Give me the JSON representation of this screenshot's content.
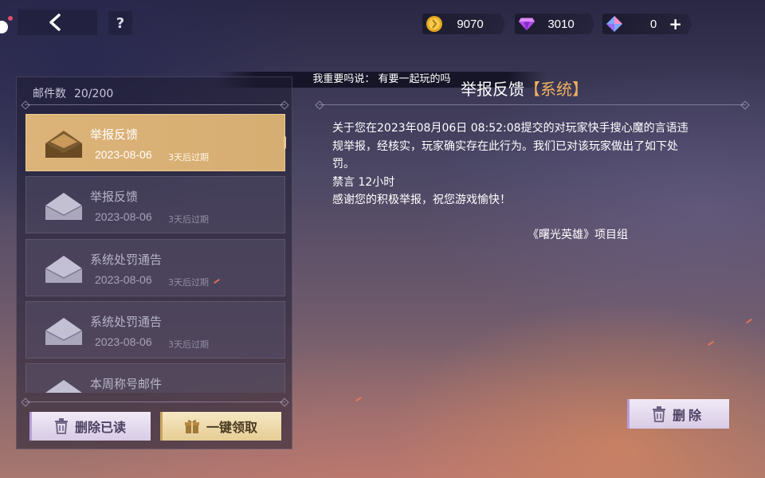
{
  "topbar": {
    "help_label": "?",
    "currencies": [
      {
        "name": "gold-coin",
        "value": "9070"
      },
      {
        "name": "purple-diamond",
        "value": "3010"
      },
      {
        "name": "crystal",
        "value": "0",
        "add_label": "+"
      }
    ]
  },
  "notice": "我重要吗说： 有要一起玩的吗",
  "mailbox": {
    "count_label": "邮件数",
    "count_value": "20/200",
    "items": [
      {
        "title": "举报反馈",
        "date": "2023-08-06",
        "expire": "3天后过期",
        "selected": true
      },
      {
        "title": "举报反馈",
        "date": "2023-08-06",
        "expire": "3天后过期",
        "selected": false
      },
      {
        "title": "系统处罚通告",
        "date": "2023-08-06",
        "expire": "3天后过期",
        "selected": false
      },
      {
        "title": "系统处罚通告",
        "date": "2023-08-06",
        "expire": "3天后过期",
        "selected": false
      },
      {
        "title": "本周称号邮件",
        "date": "",
        "expire": "",
        "selected": false
      }
    ],
    "delete_read_label": "删除已读",
    "claim_all_label": "一键领取"
  },
  "mail_detail": {
    "title": "举报反馈",
    "tag": "【系统】",
    "lines": [
      "关于您在2023年08月06日 08:52:08提交的对玩家快手搜心魔的言语违",
      "规举报，经核实，玩家确实存在此行为。我们已对该玩家做出了如下处",
      "罚。",
      "禁言 12小时",
      "感谢您的积极举报，祝您游戏愉快！"
    ],
    "signature": "《曙光英雄》项目组",
    "delete_label": "删除"
  },
  "colors": {
    "selected_item": "#dcb378",
    "tag": "#f0b060",
    "button_light": "#e8def0",
    "button_gold": "#f0dcaa"
  }
}
